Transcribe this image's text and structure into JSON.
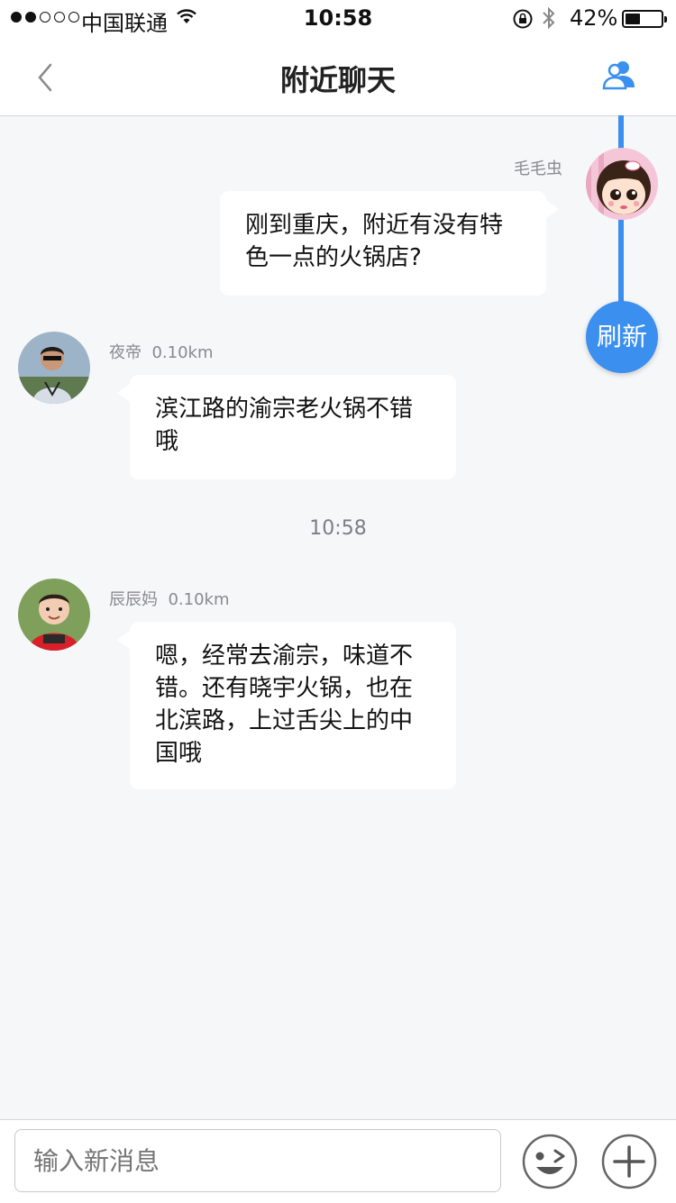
{
  "status_bar": {
    "carrier": "中国联通",
    "time": "10:58",
    "battery_percent_text": "42%",
    "battery_level": 0.42,
    "signal_strength": 2
  },
  "nav": {
    "title": "附近聊天",
    "back_icon": "chevron-left-icon",
    "right_icon": "users-icon"
  },
  "refresh_label": "刷新",
  "messages": [
    {
      "name": "毛毛虫",
      "distance": "",
      "text": "刚到重庆，附近有没有特色一点的火锅店?",
      "side": "right"
    },
    {
      "name": "夜帝",
      "distance": "0.10km",
      "text": "滨江路的渝宗老火锅不错哦",
      "side": "left"
    },
    {
      "name": "辰辰妈",
      "distance": "0.10km",
      "text": "嗯，经常去渝宗，味道不错。还有晓宇火锅，也在北滨路，上过舌尖上的中国哦",
      "side": "left"
    }
  ],
  "timestamp": "10:58",
  "input": {
    "placeholder": "输入新消息"
  },
  "colors": {
    "accent": "#3b8fef",
    "background": "#f6f7f9"
  }
}
